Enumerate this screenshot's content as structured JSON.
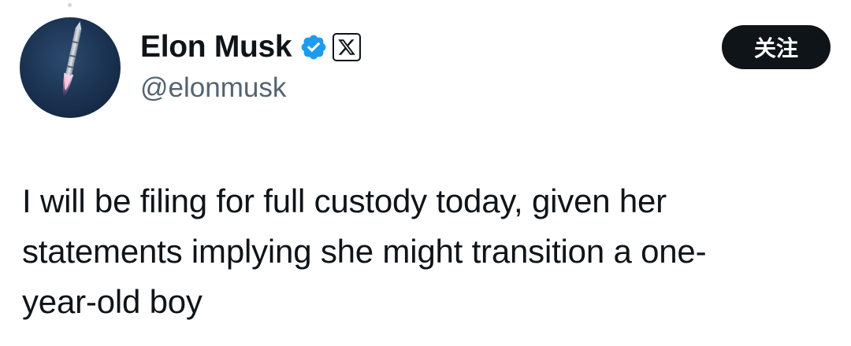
{
  "author": {
    "display_name": "Elon Musk",
    "handle": "@elonmusk",
    "verified_icon": "verified-badge-icon",
    "affiliation_icon": "x-logo-icon"
  },
  "follow_button": {
    "label": "关注"
  },
  "tweet": {
    "lines": [
      "I will be filing for full custody today, given her",
      "statements implying she might transition a one-",
      "year-old boy"
    ]
  },
  "colors": {
    "text_primary": "#0f1419",
    "text_secondary": "#536471",
    "verified_blue": "#1d9bf0",
    "button_bg": "#0f1419",
    "button_text": "#ffffff",
    "background": "#ffffff"
  }
}
